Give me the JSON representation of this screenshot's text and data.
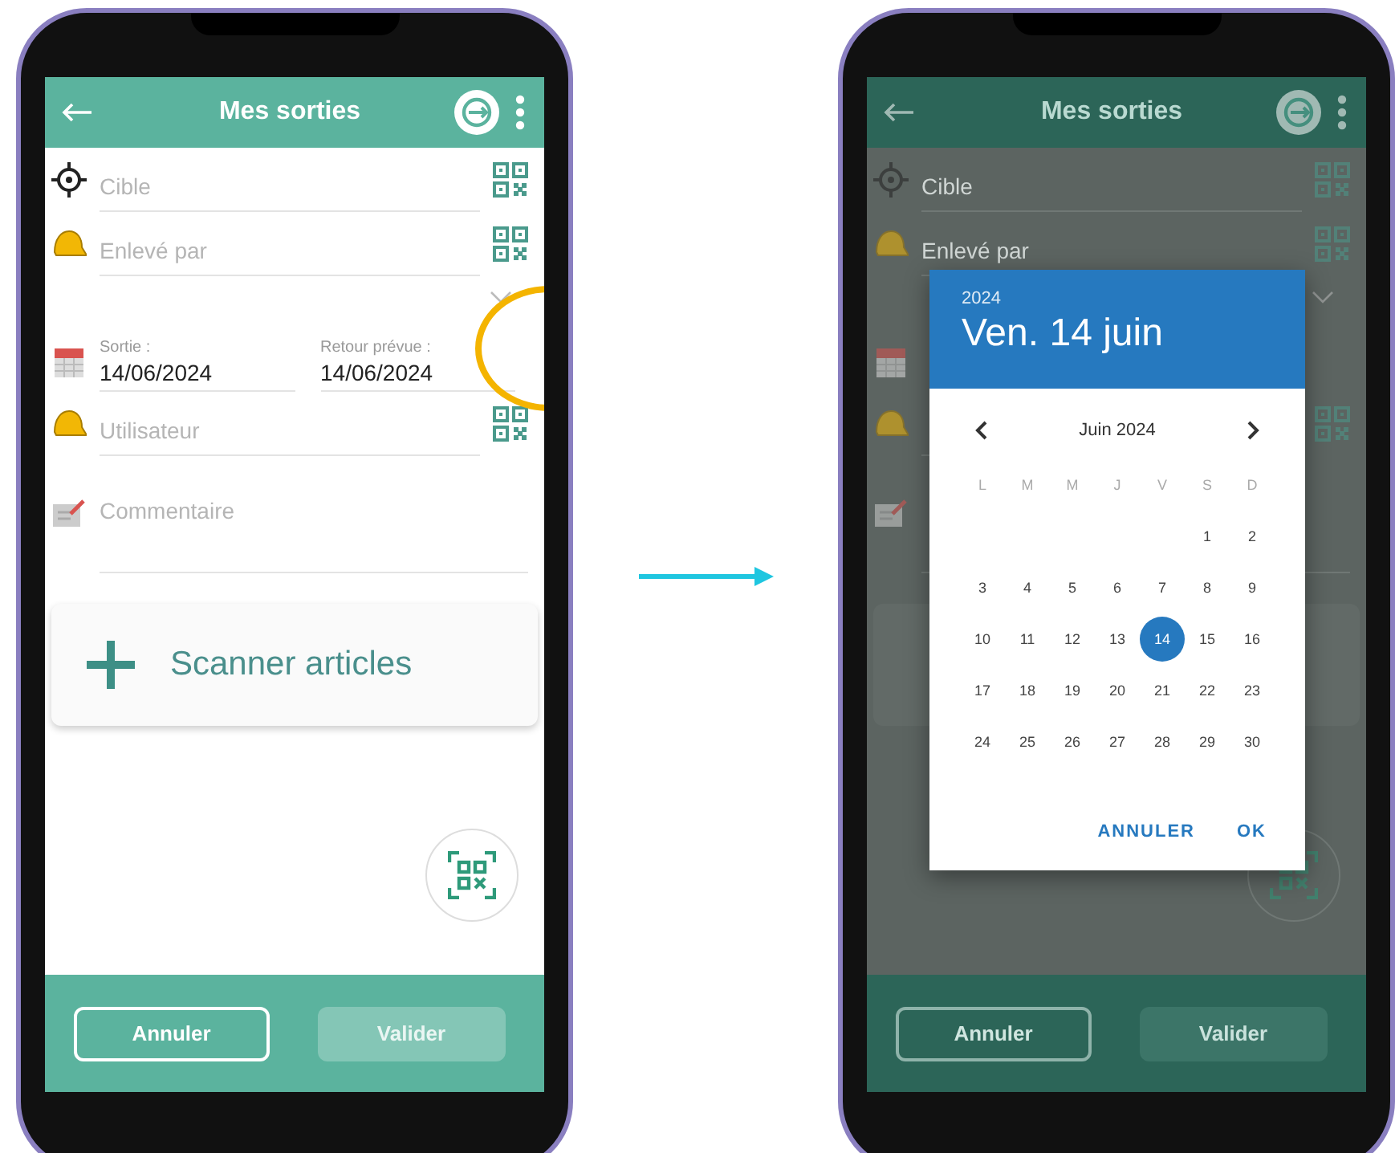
{
  "phones": [
    {
      "header": {
        "title": "Mes sorties"
      },
      "fields": [
        {
          "kind": "target",
          "placeholder": "Cible"
        },
        {
          "kind": "helmet",
          "placeholder": "Enlevé par"
        },
        {
          "kind": "dropdown"
        },
        {
          "kind": "dates",
          "dates": [
            {
              "label": "Sortie :",
              "value": "14/06/2024"
            },
            {
              "label": "Retour prévue :",
              "value": "14/06/2024"
            }
          ]
        },
        {
          "kind": "helmet",
          "placeholder": "Utilisateur"
        },
        {
          "kind": "comment",
          "placeholder": "Commentaire"
        }
      ],
      "scan_button": {
        "label": "Scanner articles"
      },
      "highlight_ring": true,
      "footer": [
        {
          "label": "Annuler",
          "disabled": false
        },
        {
          "label": "Valider",
          "disabled": true
        }
      ]
    },
    {
      "header": {
        "title": "Mes sorties"
      },
      "fields": [
        {
          "kind": "target",
          "placeholder": "Cible"
        },
        {
          "kind": "helmet",
          "placeholder": "Enlevé par"
        },
        {
          "kind": "dropdown"
        },
        {
          "kind": "dates"
        },
        {
          "kind": "helmet"
        },
        {
          "kind": "comment"
        }
      ],
      "highlight_ring": false,
      "footer": [
        {
          "label": "Annuler",
          "disabled": false
        },
        {
          "label": "Valider",
          "disabled": true
        }
      ],
      "dialog": {
        "year": "2024",
        "date": "Ven. 14 juin",
        "month": "Juin 2024",
        "weekdays": [
          "L",
          "M",
          "M",
          "J",
          "V",
          "S",
          "D"
        ],
        "weeks": [
          {
            "days": [
              {
                "label": "1",
                "selected": false
              },
              {
                "label": "2",
                "selected": false
              }
            ]
          },
          {
            "days": [
              {
                "label": "3",
                "selected": false
              },
              {
                "label": "4",
                "selected": false
              },
              {
                "label": "5",
                "selected": false
              },
              {
                "label": "6",
                "selected": false
              },
              {
                "label": "7",
                "selected": false
              },
              {
                "label": "8",
                "selected": false
              },
              {
                "label": "9",
                "selected": false
              }
            ]
          },
          {
            "days": [
              {
                "label": "10",
                "selected": false
              },
              {
                "label": "11",
                "selected": false
              },
              {
                "label": "12",
                "selected": false
              },
              {
                "label": "13",
                "selected": false
              },
              {
                "label": "14",
                "selected": true
              },
              {
                "label": "15",
                "selected": false
              },
              {
                "label": "16",
                "selected": false
              }
            ]
          },
          {
            "days": [
              {
                "label": "17",
                "selected": false
              },
              {
                "label": "18",
                "selected": false
              },
              {
                "label": "19",
                "selected": false
              },
              {
                "label": "20",
                "selected": false
              },
              {
                "label": "21",
                "selected": false
              },
              {
                "label": "22",
                "selected": false
              },
              {
                "label": "23",
                "selected": false
              }
            ]
          },
          {
            "days": [
              {
                "label": "24",
                "selected": false
              },
              {
                "label": "25",
                "selected": false
              },
              {
                "label": "26",
                "selected": false
              },
              {
                "label": "27",
                "selected": false
              },
              {
                "label": "28",
                "selected": false
              },
              {
                "label": "29",
                "selected": false
              },
              {
                "label": "30",
                "selected": false
              }
            ]
          }
        ],
        "actions": [
          "ANNULER",
          "OK"
        ]
      }
    }
  ]
}
